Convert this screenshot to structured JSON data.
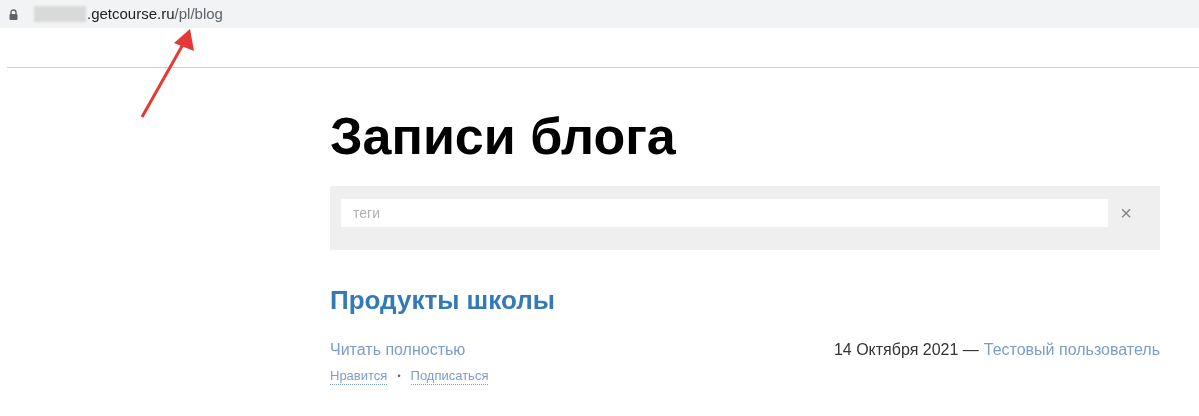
{
  "address_bar": {
    "url_domain": ".getcourse.ru",
    "url_path": "/pl/blog"
  },
  "page": {
    "title": "Записи блога",
    "tag_search": {
      "placeholder": "теги",
      "clear": "×"
    },
    "posts": [
      {
        "title": "Продукты школы",
        "read_more": "Читать полностью",
        "date": "14 Октября 2021 —",
        "author": "Тестовый пользователь",
        "actions": [
          "Нравится",
          "Подписаться"
        ],
        "separator": "•"
      }
    ]
  }
}
